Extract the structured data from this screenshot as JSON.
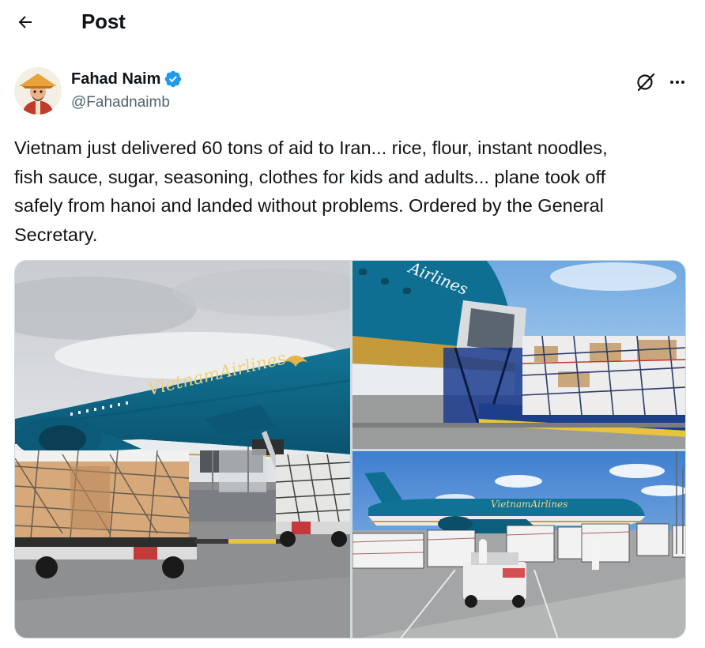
{
  "header": {
    "title": "Post",
    "back_icon": "arrow-left-icon"
  },
  "author": {
    "name": "Fahad Naim",
    "handle": "@Fahadnaimb",
    "verified_icon": "verified-badge-icon",
    "verified_color": "#1d9bf0"
  },
  "post": {
    "text": "Vietnam just delivered 60 tons of aid to Iran... rice, flour, instant noodles,\nfish sauce, sugar, seasoning, clothes for kids and adults... plane took off\nsafely from hanoi and landed without problems. Ordered by the General\nSecretary."
  },
  "media": {
    "photo1_logo": "VietnamAirlines",
    "photo3_logo": "VietnamAirlines",
    "photo2_logo": "Airlines"
  },
  "colors": {
    "text": "#0f1419",
    "secondary": "#536471",
    "livery": "#0e6b8a",
    "gold": "#d9a630"
  }
}
